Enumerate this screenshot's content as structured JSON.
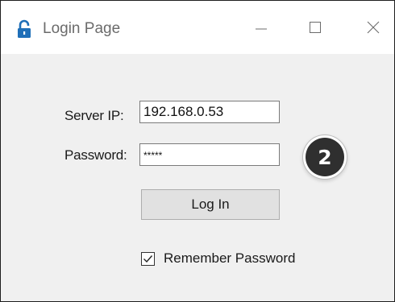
{
  "window": {
    "title": "Login Page",
    "title_icon": "lock-icon",
    "controls": {
      "minimize_icon": "minimize-icon",
      "maximize_icon": "maximize-icon",
      "close_icon": "close-icon"
    }
  },
  "form": {
    "server_ip": {
      "label": "Server IP:",
      "value": "192.168.0.53"
    },
    "password": {
      "label": "Password:",
      "value": "*****"
    },
    "login_button": {
      "label": "Log In"
    },
    "remember": {
      "label": "Remember Password",
      "checked": true
    }
  },
  "annotation": {
    "badge_number": "2"
  },
  "colors": {
    "lock_icon": "#1f6fb8",
    "window_bg": "#f0f0f0",
    "titlebar_bg": "#ffffff",
    "badge_bg": "#2f2f2f",
    "button_bg": "#e1e1e1"
  }
}
